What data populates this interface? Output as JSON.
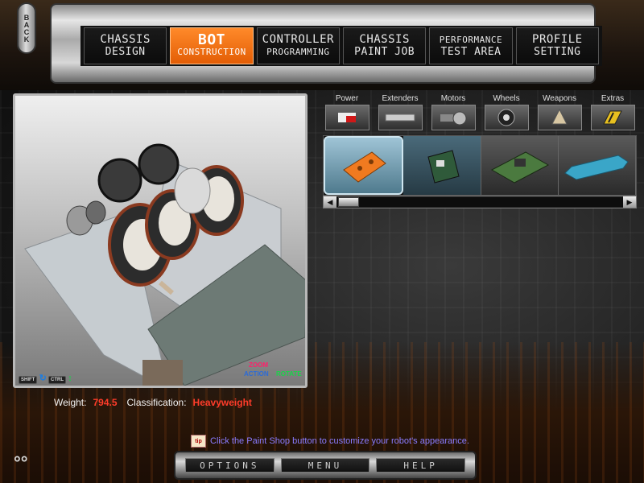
{
  "back": {
    "label": "BACK"
  },
  "nav": {
    "tabs": [
      {
        "line1": "CHASSIS",
        "line2": "DESIGN"
      },
      {
        "line1": "BOT",
        "line2": "CONSTRUCTION"
      },
      {
        "line1": "CONTROLLER",
        "line2": "PROGRAMMING"
      },
      {
        "line1": "CHASSIS",
        "line2": "PAINT JOB"
      },
      {
        "line1": "PERFORMANCE",
        "line2": "TEST AREA"
      },
      {
        "line1": "PROFILE",
        "line2": "SETTING"
      }
    ],
    "active_index": 1
  },
  "viewport": {
    "shift_key": "SHIFT",
    "ctrl_key": "CTRL",
    "zoom_label": "ZOOM",
    "action_label": "ACTION",
    "rotate_label": "ROTATE"
  },
  "categories": [
    {
      "label": "Power",
      "icon": "battery-icon"
    },
    {
      "label": "Extenders",
      "icon": "extender-bar-icon"
    },
    {
      "label": "Motors",
      "icon": "motor-icon"
    },
    {
      "label": "Wheels",
      "icon": "wheel-icon"
    },
    {
      "label": "Weapons",
      "icon": "spike-icon"
    },
    {
      "label": "Extras",
      "icon": "hazard-plate-icon"
    }
  ],
  "parts": [
    {
      "icon": "orange-plate-part",
      "state": "selected"
    },
    {
      "icon": "circuit-board-part",
      "state": "hover"
    },
    {
      "icon": "green-board-part",
      "state": "normal"
    },
    {
      "icon": "blue-cylinder-part",
      "state": "normal"
    }
  ],
  "stats": {
    "weight_label": "Weight:",
    "weight_value": "794.5",
    "class_label": "Classification:",
    "class_value": "Heavyweight"
  },
  "tip": {
    "icon_text": "tip",
    "text": "Click the Paint Shop button to customize your robot's appearance."
  },
  "bottom": {
    "options": "OPTIONS",
    "menu": "MENU",
    "help": "HELP"
  },
  "colors": {
    "accent": "#f26a10",
    "value_red": "#ff3c2a",
    "tip_text": "#8a7cff"
  }
}
